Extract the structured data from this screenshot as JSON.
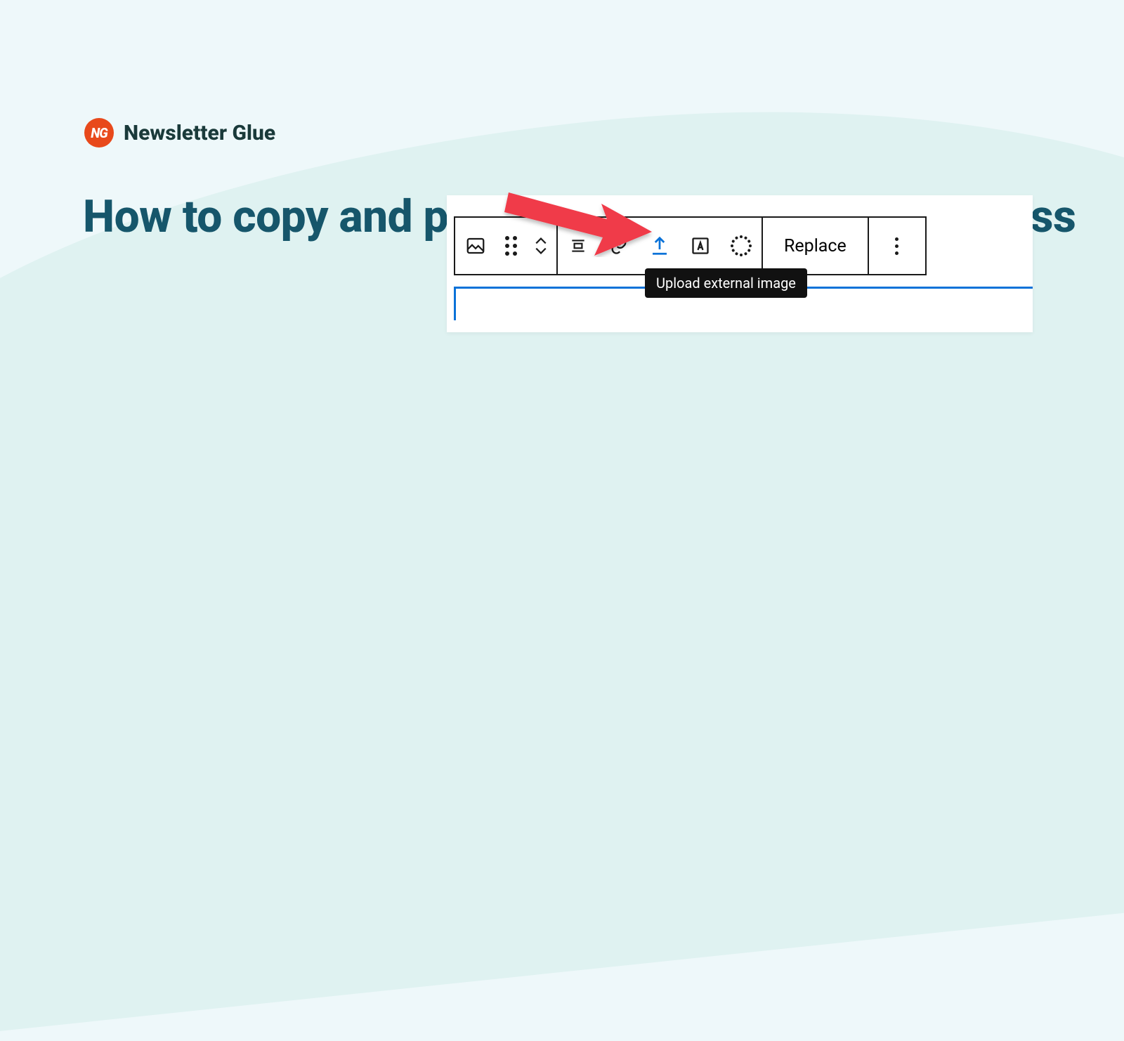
{
  "brand": {
    "badge_text": "NG",
    "name": "Newsletter Glue"
  },
  "headline": "How to copy and paste Google Docs to WordPress",
  "toolbar": {
    "replace_label": "Replace",
    "tooltip": "Upload external image"
  }
}
